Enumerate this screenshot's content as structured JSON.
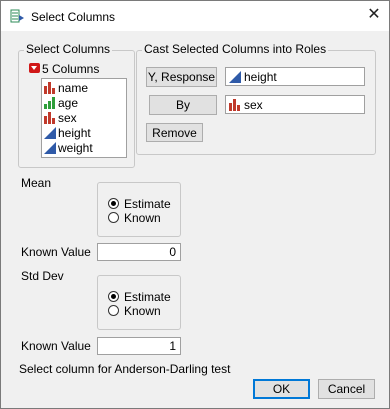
{
  "window": {
    "title": "Select Columns",
    "close_glyph": "✕"
  },
  "select_columns": {
    "group_label": "Select Columns",
    "count_label": "5 Columns",
    "items": [
      {
        "label": "name",
        "icon": "nominal-icon"
      },
      {
        "label": "age",
        "icon": "ordinal-icon"
      },
      {
        "label": "sex",
        "icon": "nominal-icon"
      },
      {
        "label": "height",
        "icon": "continuous-icon"
      },
      {
        "label": "weight",
        "icon": "continuous-icon"
      }
    ]
  },
  "roles": {
    "group_label": "Cast Selected Columns into Roles",
    "y_button": "Y, Response",
    "y_value": "height",
    "by_button": "By",
    "by_value": "sex",
    "remove_button": "Remove"
  },
  "mean": {
    "label": "Mean",
    "options": [
      "Estimate",
      "Known"
    ],
    "selected": "Estimate",
    "known_value_label": "Known Value",
    "known_value": "0"
  },
  "std_dev": {
    "label": "Std Dev",
    "options": [
      "Estimate",
      "Known"
    ],
    "selected": "Estimate",
    "known_value_label": "Known Value",
    "known_value": "1"
  },
  "anderson_label": "Select column for Anderson-Darling test",
  "buttons": {
    "ok": "OK",
    "cancel": "Cancel"
  },
  "colors": {
    "nominal": "#c0392b",
    "ordinal": "#2e9e3a",
    "continuous": "#2f5aa8",
    "accent": "#0078d7"
  }
}
